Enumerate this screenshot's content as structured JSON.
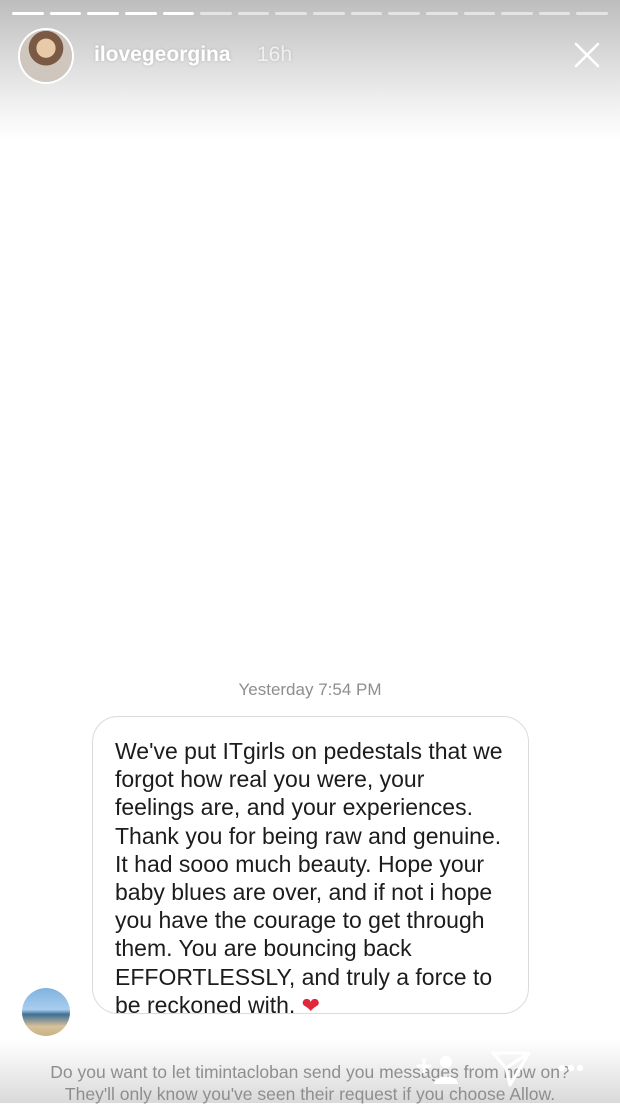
{
  "story": {
    "username": "ilovegeorgina",
    "time_ago": "16h",
    "segments_total": 16,
    "segments_viewed": 5
  },
  "message": {
    "timestamp": "Yesterday 7:54 PM",
    "text": "We've put ITgirls on pedestals that we forgot how real you were, your feelings are, and your experiences. Thank you for being raw and genuine. It had sooo much beauty. Hope your baby blues are over, and if not i hope you have the courage to get through them. You are bouncing back EFFORTLESSLY, and truly a force to be reckoned with.",
    "emoji": "❤"
  },
  "request_prompt": {
    "line1": "Do you want to let timintacloban send you messages from now on?",
    "line2": "They'll only know you've seen their request if you choose Allow."
  },
  "icons": {
    "close": "close-icon",
    "add_friend": "add-user-icon",
    "send": "send-icon",
    "more": "more-icon"
  },
  "colors": {
    "heart": "#e0283a",
    "muted_text": "#8e8e8e",
    "bubble_border": "#dbdbdb"
  }
}
